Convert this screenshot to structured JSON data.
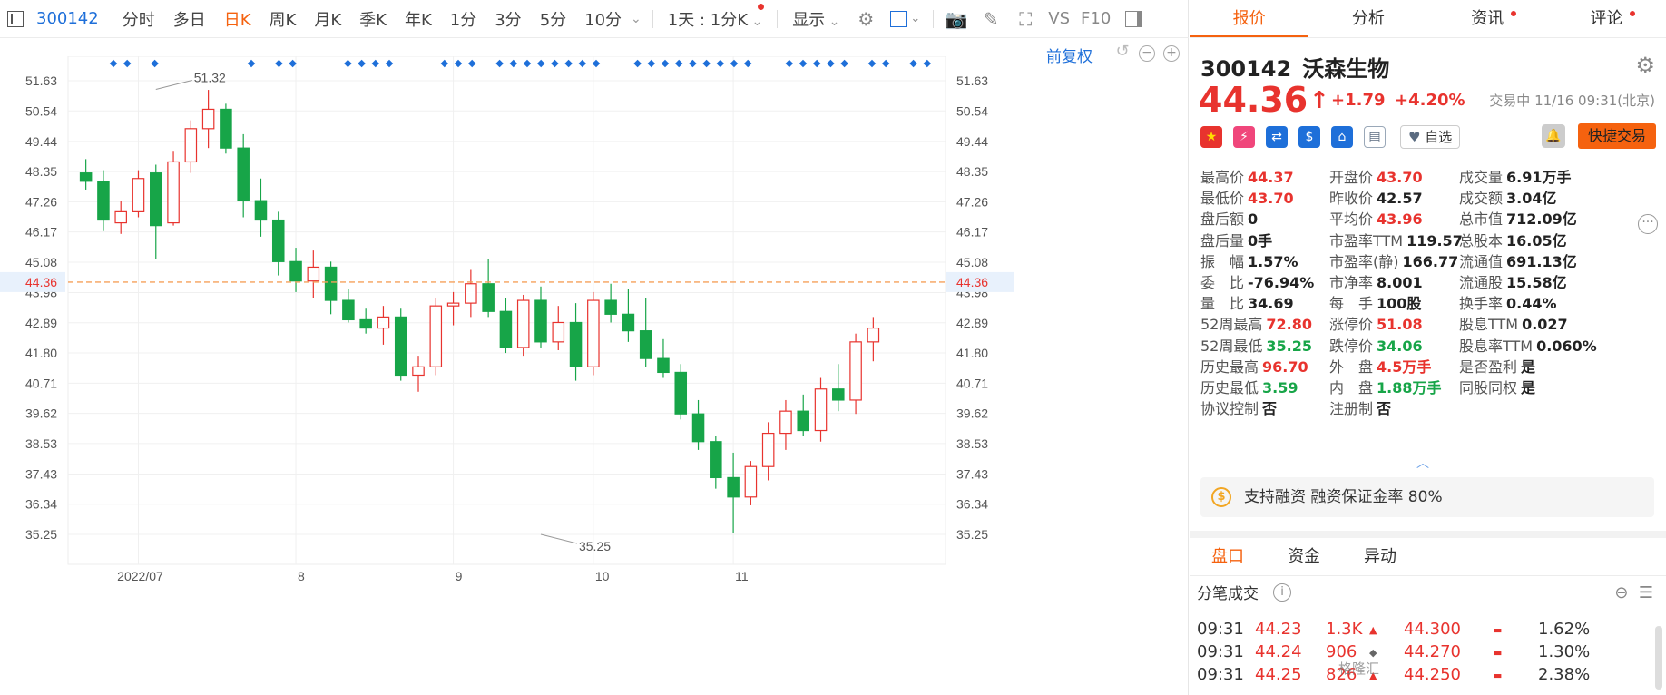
{
  "toolbar": {
    "code": "300142",
    "tabs": [
      "分时",
      "多日",
      "日K",
      "周K",
      "月K",
      "季K",
      "年K",
      "1分",
      "3分",
      "5分",
      "10分"
    ],
    "active_tab": "日K",
    "interval": "1天 : 1分K",
    "show": "显示",
    "vs": "VS",
    "f10": "F10",
    "fuquan": "前复权"
  },
  "chart_data": {
    "type": "candlestick",
    "title": "",
    "ylim": [
      34.5,
      52.5
    ],
    "y_ticks": [
      "51.63",
      "50.54",
      "49.44",
      "48.35",
      "47.26",
      "46.17",
      "45.08",
      "43.98",
      "42.89",
      "41.80",
      "40.71",
      "39.62",
      "38.53",
      "37.43",
      "36.34",
      "35.25"
    ],
    "x_labels": [
      {
        "label": "2022/07",
        "index": 3
      },
      {
        "label": "8",
        "index": 12
      },
      {
        "label": "9",
        "index": 21
      },
      {
        "label": "10",
        "index": 29
      },
      {
        "label": "11",
        "index": 37
      }
    ],
    "current_price": "44.36",
    "current_value": 44.36,
    "max_label": "51.32",
    "max_value": 51.32,
    "max_index": 4,
    "min_label": "35.25",
    "min_value": 35.25,
    "min_index": 26,
    "candles": [
      [
        48.3,
        48.8,
        47.7,
        48.0
      ],
      [
        48.0,
        48.4,
        46.2,
        46.6
      ],
      [
        46.5,
        47.3,
        46.1,
        46.9
      ],
      [
        46.9,
        48.4,
        46.7,
        48.1
      ],
      [
        48.3,
        48.6,
        45.2,
        46.4
      ],
      [
        46.5,
        49.1,
        46.4,
        48.7
      ],
      [
        48.7,
        50.2,
        48.3,
        49.9
      ],
      [
        49.9,
        51.3,
        49.2,
        50.6
      ],
      [
        50.6,
        50.8,
        49.0,
        49.2
      ],
      [
        49.2,
        49.7,
        46.7,
        47.3
      ],
      [
        47.3,
        48.1,
        46.0,
        46.6
      ],
      [
        46.6,
        46.9,
        44.6,
        45.1
      ],
      [
        45.1,
        45.6,
        44.0,
        44.4
      ],
      [
        44.4,
        45.5,
        43.8,
        44.9
      ],
      [
        44.9,
        45.1,
        43.2,
        43.7
      ],
      [
        43.7,
        44.1,
        42.9,
        43.0
      ],
      [
        43.0,
        43.4,
        42.5,
        42.7
      ],
      [
        42.7,
        43.5,
        42.1,
        43.1
      ],
      [
        43.1,
        43.4,
        40.8,
        41.0
      ],
      [
        41.0,
        41.7,
        40.4,
        41.3
      ],
      [
        41.3,
        43.8,
        41.0,
        43.5
      ],
      [
        43.5,
        44.0,
        42.8,
        43.6
      ],
      [
        43.6,
        44.8,
        43.1,
        44.3
      ],
      [
        44.3,
        45.2,
        43.1,
        43.3
      ],
      [
        43.3,
        43.8,
        41.8,
        42.0
      ],
      [
        42.0,
        43.9,
        41.7,
        43.7
      ],
      [
        43.7,
        44.2,
        42.0,
        42.2
      ],
      [
        42.2,
        43.5,
        41.9,
        42.9
      ],
      [
        42.9,
        43.6,
        40.8,
        41.3
      ],
      [
        41.3,
        44.0,
        41.0,
        43.7
      ],
      [
        43.7,
        44.3,
        42.9,
        43.2
      ],
      [
        43.2,
        44.1,
        42.2,
        42.6
      ],
      [
        42.6,
        43.8,
        41.3,
        41.6
      ],
      [
        41.6,
        42.3,
        40.9,
        41.1
      ],
      [
        41.1,
        41.4,
        39.4,
        39.6
      ],
      [
        39.6,
        40.1,
        38.3,
        38.6
      ],
      [
        38.6,
        38.8,
        36.9,
        37.3
      ],
      [
        37.3,
        38.2,
        35.3,
        36.6
      ],
      [
        36.6,
        37.9,
        36.3,
        37.7
      ],
      [
        37.7,
        39.3,
        37.2,
        38.9
      ],
      [
        38.9,
        40.1,
        38.3,
        39.7
      ],
      [
        39.7,
        40.3,
        38.8,
        39.0
      ],
      [
        39.0,
        40.9,
        38.6,
        40.5
      ],
      [
        40.5,
        41.4,
        39.7,
        40.1
      ],
      [
        40.1,
        42.5,
        39.6,
        42.2
      ],
      [
        42.2,
        43.1,
        41.5,
        42.7
      ]
    ],
    "markers": [
      0,
      1,
      3,
      10,
      12,
      13,
      17,
      18,
      19,
      20,
      24,
      25,
      26,
      28,
      29,
      30,
      31,
      32,
      33,
      34,
      35,
      38,
      39,
      40,
      41,
      42,
      43,
      44,
      45,
      46,
      49,
      50,
      51,
      52,
      53,
      55,
      56,
      58,
      59
    ]
  },
  "quote": {
    "tabs": [
      "报价",
      "分析",
      "资讯",
      "评论"
    ],
    "code": "300142",
    "name": "沃森生物",
    "price": "44.36",
    "change": "+1.79",
    "change_pct": "+4.20%",
    "status": "交易中 11/16 09:31(北京)",
    "watch_label": "自选",
    "quick_trade": "快捷交易",
    "stats": [
      [
        {
          "k": "最高价",
          "v": "44.37",
          "c": "r"
        },
        {
          "k": "开盘价",
          "v": "43.70",
          "c": "r"
        },
        {
          "k": "成交量",
          "v": "6.91万手",
          "c": ""
        }
      ],
      [
        {
          "k": "最低价",
          "v": "43.70",
          "c": "r"
        },
        {
          "k": "昨收价",
          "v": "42.57",
          "c": ""
        },
        {
          "k": "成交额",
          "v": "3.04亿",
          "c": ""
        }
      ],
      [
        {
          "k": "盘后额",
          "v": "0",
          "c": ""
        },
        {
          "k": "平均价",
          "v": "43.96",
          "c": "r"
        },
        {
          "k": "总市值",
          "v": "712.09亿",
          "c": ""
        }
      ],
      [
        {
          "k": "盘后量",
          "v": "0手",
          "c": ""
        },
        {
          "k": "市盈率TTM",
          "v": "119.57",
          "c": ""
        },
        {
          "k": "总股本",
          "v": "16.05亿",
          "c": ""
        }
      ],
      [
        {
          "k": "振　幅",
          "v": "1.57%",
          "c": ""
        },
        {
          "k": "市盈率(静)",
          "v": "166.77",
          "c": ""
        },
        {
          "k": "流通值",
          "v": "691.13亿",
          "c": ""
        }
      ],
      [
        {
          "k": "委　比",
          "v": "-76.94%",
          "c": ""
        },
        {
          "k": "市净率",
          "v": "8.001",
          "c": ""
        },
        {
          "k": "流通股",
          "v": "15.58亿",
          "c": ""
        }
      ],
      [
        {
          "k": "量　比",
          "v": "34.69",
          "c": ""
        },
        {
          "k": "每　手",
          "v": "100股",
          "c": ""
        },
        {
          "k": "换手率",
          "v": "0.44%",
          "c": ""
        }
      ],
      [
        {
          "k": "52周最高",
          "v": "72.80",
          "c": "r"
        },
        {
          "k": "涨停价",
          "v": "51.08",
          "c": "r"
        },
        {
          "k": "股息TTM",
          "v": "0.027",
          "c": ""
        }
      ],
      [
        {
          "k": "52周最低",
          "v": "35.25",
          "c": "g"
        },
        {
          "k": "跌停价",
          "v": "34.06",
          "c": "g"
        },
        {
          "k": "股息率TTM",
          "v": "0.060%",
          "c": ""
        }
      ],
      [
        {
          "k": "历史最高",
          "v": "96.70",
          "c": "r"
        },
        {
          "k": "外　盘",
          "v": "4.5万手",
          "c": "r"
        },
        {
          "k": "是否盈利",
          "v": "是",
          "c": ""
        }
      ],
      [
        {
          "k": "历史最低",
          "v": "3.59",
          "c": "g"
        },
        {
          "k": "内　盘",
          "v": "1.88万手",
          "c": "g"
        },
        {
          "k": "同股同权",
          "v": "是",
          "c": ""
        }
      ],
      [
        {
          "k": "协议控制",
          "v": "否",
          "c": ""
        },
        {
          "k": "注册制",
          "v": "否",
          "c": ""
        },
        {
          "k": "",
          "v": "",
          "c": ""
        }
      ]
    ],
    "margin_text": "支持融资 融资保证金率 80%",
    "bottom_tabs": [
      "盘口",
      "资金",
      "异动"
    ],
    "fb_title": "分笔成交",
    "trades": [
      {
        "time": "09:31",
        "price": "44.23",
        "vol": "1.3K",
        "dir": "up"
      },
      {
        "time": "09:31",
        "price": "44.24",
        "vol": "906",
        "dir": "flat"
      },
      {
        "time": "09:31",
        "price": "44.25",
        "vol": "826",
        "dir": "up"
      }
    ],
    "levels": [
      {
        "price": "44.300",
        "pct": "1.62%"
      },
      {
        "price": "44.270",
        "pct": "1.30%"
      },
      {
        "price": "44.250",
        "pct": "2.38%"
      }
    ]
  },
  "colors": {
    "up": "#e8332e",
    "down": "#17a548",
    "accent": "#f5620f",
    "blue": "#1e6fd9"
  },
  "watermark": "格隆汇"
}
